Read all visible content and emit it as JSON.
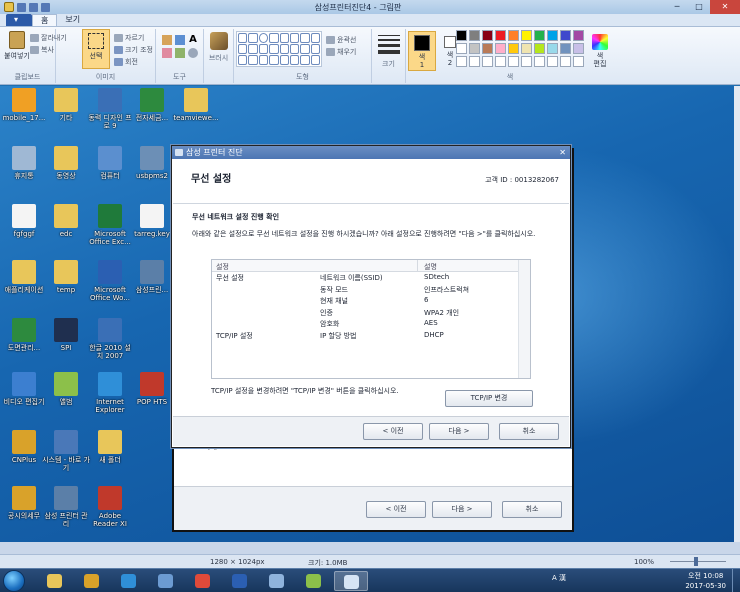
{
  "window": {
    "title": "삼성프린터진단4 - 그림판"
  },
  "tabs": [
    {
      "label": ""
    },
    {
      "label": "홈"
    },
    {
      "label": "보기"
    }
  ],
  "ribbon": {
    "clipboard": {
      "paste": "붙여넣기",
      "cut": "잘라내기",
      "copy": "복사",
      "label": "클립보드"
    },
    "image": {
      "select": "선택",
      "crop": "자르기",
      "resize": "크기 조정",
      "rotate": "회전",
      "label": "이미지"
    },
    "tools": {
      "label": "도구"
    },
    "brushes": {
      "label": "브러시"
    },
    "shapes": {
      "outline": "윤곽선",
      "fill": "채우기",
      "label": "도형"
    },
    "size": {
      "label": "크기"
    },
    "colors": {
      "color1": "색\n1",
      "color2": "색\n2",
      "edit": "색\n편집",
      "label": "색"
    }
  },
  "swatch_colors": [
    "#000000",
    "#7f7f7f",
    "#880015",
    "#ed1c24",
    "#ff7f27",
    "#fff200",
    "#22b14c",
    "#00a2e8",
    "#3f48cc",
    "#a349a4",
    "#ffffff",
    "#c3c3c3",
    "#b97a57",
    "#ffaec9",
    "#ffc90e",
    "#efe4b0",
    "#b5e61d",
    "#99d9ea",
    "#7092be",
    "#c8bfe7",
    "#ffffff",
    "#ffffff",
    "#ffffff",
    "#ffffff",
    "#ffffff",
    "#ffffff",
    "#ffffff",
    "#ffffff",
    "#ffffff",
    "#ffffff"
  ],
  "desktop_icons": [
    {
      "label": "mobile_17...",
      "color": "#f0a024"
    },
    {
      "label": "기타",
      "color": "#e8c65a"
    },
    {
      "label": "동력 디자인 프로 9",
      "color": "#3a6fb6"
    },
    {
      "label": "전자세금...",
      "color": "#2d8a3e"
    },
    {
      "label": "teamviewe...",
      "color": "#e8c65a"
    },
    {
      "label": "휴지통",
      "color": "#9fb8d4"
    },
    {
      "label": "동영상",
      "color": "#e8c65a"
    },
    {
      "label": "컴퓨터",
      "color": "#5b8fcf"
    },
    {
      "label": "usbpms2",
      "color": "#6c8fb6"
    },
    {
      "label": "fgfggf",
      "color": "#f4f4f4"
    },
    {
      "label": "edc",
      "color": "#e8c65a"
    },
    {
      "label": "Microsoft Office Exc...",
      "color": "#1f7a3a"
    },
    {
      "label": "tarreg.key",
      "color": "#f4f4f4"
    },
    {
      "label": "애플리케이션",
      "color": "#e8c65a"
    },
    {
      "label": "temp",
      "color": "#e8c65a"
    },
    {
      "label": "Microsoft Office Wo...",
      "color": "#2b5fb2"
    },
    {
      "label": "삼성프린...",
      "color": "#5b7fa8"
    },
    {
      "label": "도면관리...",
      "color": "#2d8a3e"
    },
    {
      "label": "SPI",
      "color": "#1f2f4f"
    },
    {
      "label": "한글 2010 설치 2007",
      "color": "#3a6fb6"
    },
    {
      "label": "비디오 편집기",
      "color": "#3c7fd0"
    },
    {
      "label": "앨범",
      "color": "#8cc04a"
    },
    {
      "label": "Internet Explorer",
      "color": "#2f8fd8"
    },
    {
      "label": "POP HTS",
      "color": "#c0392b"
    },
    {
      "label": "CNPlus",
      "color": "#d9a22a"
    },
    {
      "label": "시스템 - 바로 가기",
      "color": "#4a78b8"
    },
    {
      "label": "새 폴더",
      "color": "#e8c65a"
    },
    {
      "label": "공시의세무",
      "color": "#d9a22a"
    },
    {
      "label": "삼성 프린터 관리",
      "color": "#5b7fa8"
    },
    {
      "label": "Adobe Reader XI",
      "color": "#c0392b"
    }
  ],
  "background_dialog": {
    "hidden_text": "하세요.",
    "back": "< 이전",
    "next": "다음 >",
    "cancel": "취소"
  },
  "dialog": {
    "title": "삼성 프린터 진단",
    "header": "무선 설정",
    "customer": "고객 ID : 0013282067",
    "section_title": "무선 네트워크 설정 진행 확인",
    "instruction": "아래와 같은 설정으로 무선 네트워크 설정을 진행 하시겠습니까? 아래 설정으로 진행하려면 \"다음 >\"를 클릭하십시오.",
    "table": {
      "headers": [
        "설정",
        "",
        "설명"
      ],
      "rows": [
        [
          "무선 설정",
          "네트워크 이름(SSID)",
          "SDtech"
        ],
        [
          "",
          "동작 모드",
          "인프라스트럭쳐"
        ],
        [
          "",
          "현재 채널",
          "6"
        ],
        [
          "",
          "인증",
          "WPA2 개인"
        ],
        [
          "",
          "암호화",
          "AES"
        ],
        [
          "TCP/IP 설정",
          "IP 할당 방법",
          "DHCP"
        ]
      ]
    },
    "tcp_note": "TCP/IP 설정을 변경하려면 \"TCP/IP 변경\" 버튼을 클릭하십시오.",
    "tcp_button": "TCP/IP 변경",
    "back": "< 이전",
    "next": "다음 >",
    "cancel": "취소"
  },
  "statusbar": {
    "dimensions": "1280 × 1024px",
    "filesize": "크기: 1.0MB",
    "zoom": "100%"
  },
  "taskbar": {
    "apps": [
      {
        "name": "explorer",
        "color": "#e8c65a"
      },
      {
        "name": "cnplus",
        "color": "#d9a22a"
      },
      {
        "name": "ie",
        "color": "#2f8fd8"
      },
      {
        "name": "window",
        "color": "#6c9bd2"
      },
      {
        "name": "chrome",
        "color": "#e04a3a"
      },
      {
        "name": "word",
        "color": "#2b5fb2"
      },
      {
        "name": "hangul",
        "color": "#8fb3dc"
      },
      {
        "name": "album",
        "color": "#8cc04a"
      },
      {
        "name": "paint",
        "color": "#d6e4f4"
      }
    ],
    "tray": "A 漢",
    "time": "오전 10:08",
    "date": "2017-05-30"
  }
}
